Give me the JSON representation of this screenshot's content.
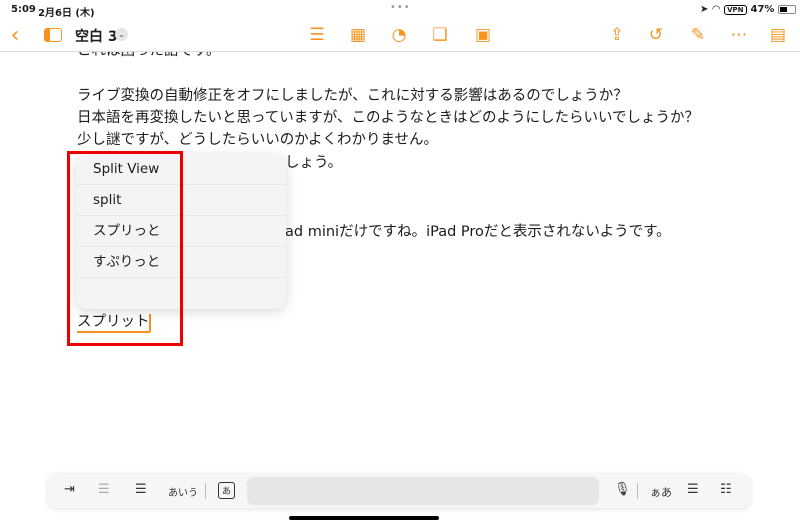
{
  "status": {
    "time": "5:09",
    "date": "2月6日 (木)",
    "vpn": "VPN",
    "battery": "47%"
  },
  "header": {
    "title": "空白 3",
    "icons": [
      "back-icon",
      "sidebar-icon",
      "list-icon",
      "table-icon",
      "chart-icon",
      "shape-icon",
      "media-icon",
      "share-icon",
      "undo-icon",
      "format-brush-icon",
      "more-icon",
      "document-view-icon"
    ]
  },
  "document": {
    "lines": [
      "これは困った話です。",
      "ライブ変換の自動修正をオフにしましたが、これに対する影響はあるのでしょうか？",
      "日本語を再変換したいと思っていますが、このようなときはどのようにしたらいいでしょうか？",
      "少し謎ですが、どうしたらいいのかよくわかりません。",
      "しょう。",
      "ad miniだけですね。iPad Proだと表示されないようです。"
    ],
    "input": "スプリット"
  },
  "popup": {
    "items": [
      "Split View",
      "split",
      "スプリっと",
      "すぷりっと"
    ]
  },
  "keyboard_bar": {
    "kana": "あいう",
    "kana_key": "あ",
    "font_size": "ぁあ"
  }
}
